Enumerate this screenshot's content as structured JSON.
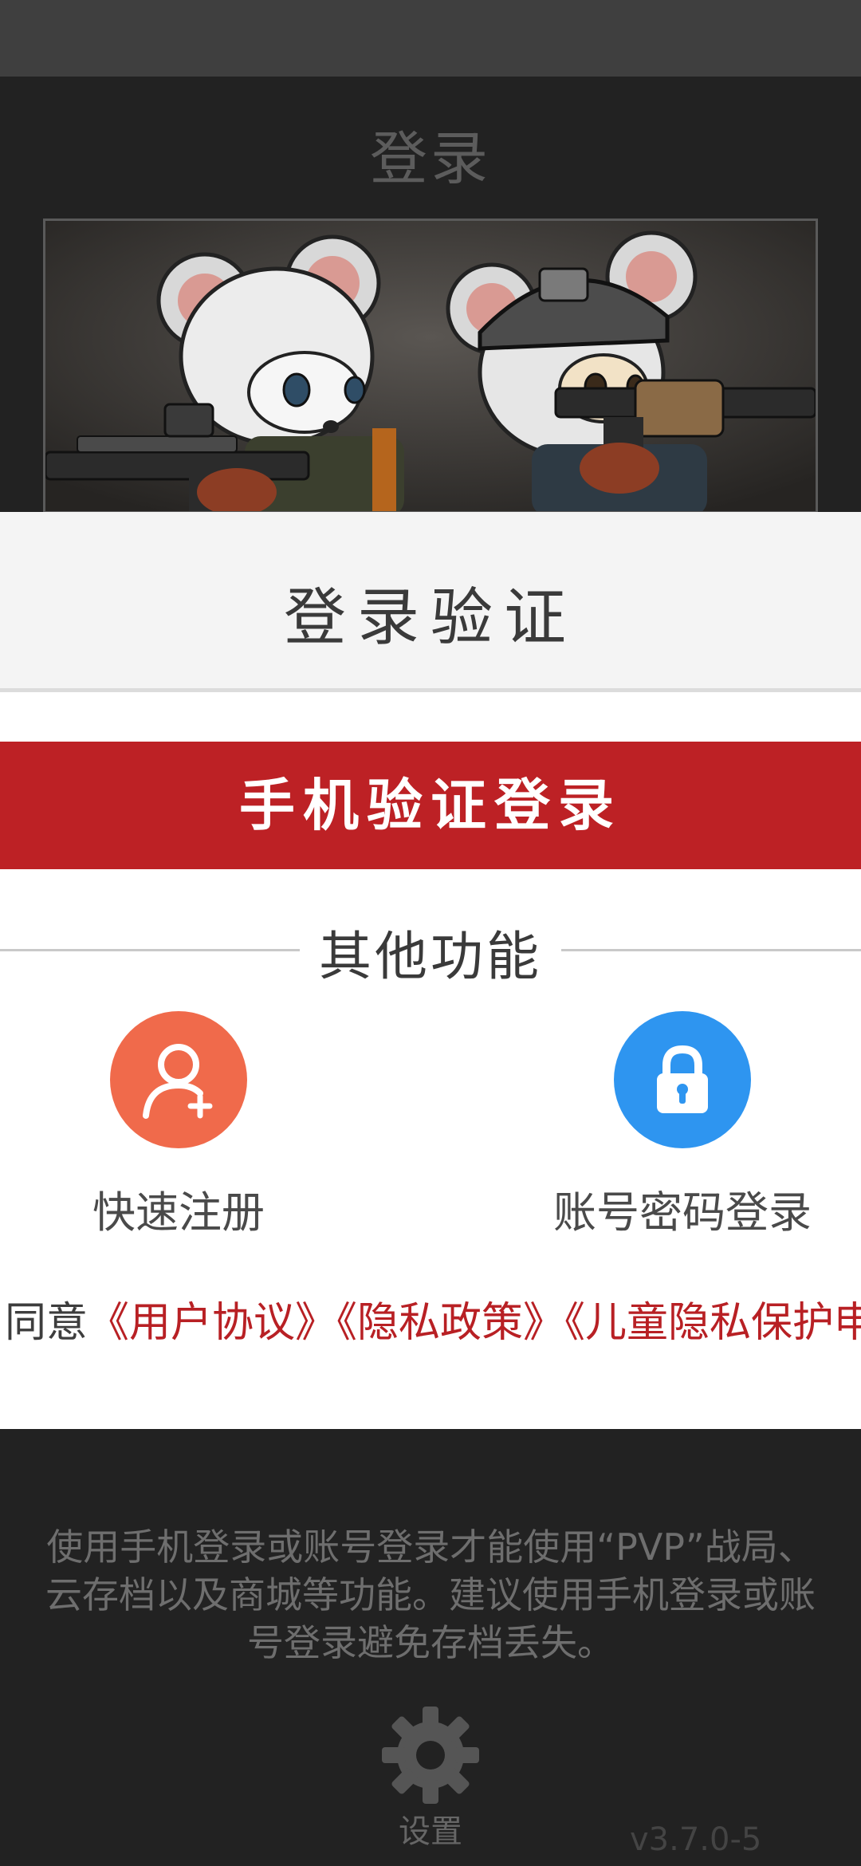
{
  "background": {
    "title": "登录",
    "notice": "使用手机登录或账号登录才能使用“PVP”战局、云存档以及商城等功能。建议使用手机登录或账号登录避免存档丢失。",
    "settings_label": "设置",
    "version": "v3.7.0-5"
  },
  "modal": {
    "title": "登录验证",
    "phone_login_label": "手机验证登录",
    "other_section_label": "其他功能",
    "actions": [
      {
        "label": "快速注册",
        "icon": "user-add-icon",
        "color": "#f06a4b"
      },
      {
        "label": "账号密码登录",
        "icon": "lock-icon",
        "color": "#2e95f0"
      }
    ],
    "agreement": {
      "prefix": "同意",
      "links": [
        "《用户协议》",
        "《隐私政策》",
        "《儿童隐私保护申"
      ]
    }
  },
  "colors": {
    "accent_red": "#bd2125",
    "link_red": "#b82024"
  }
}
